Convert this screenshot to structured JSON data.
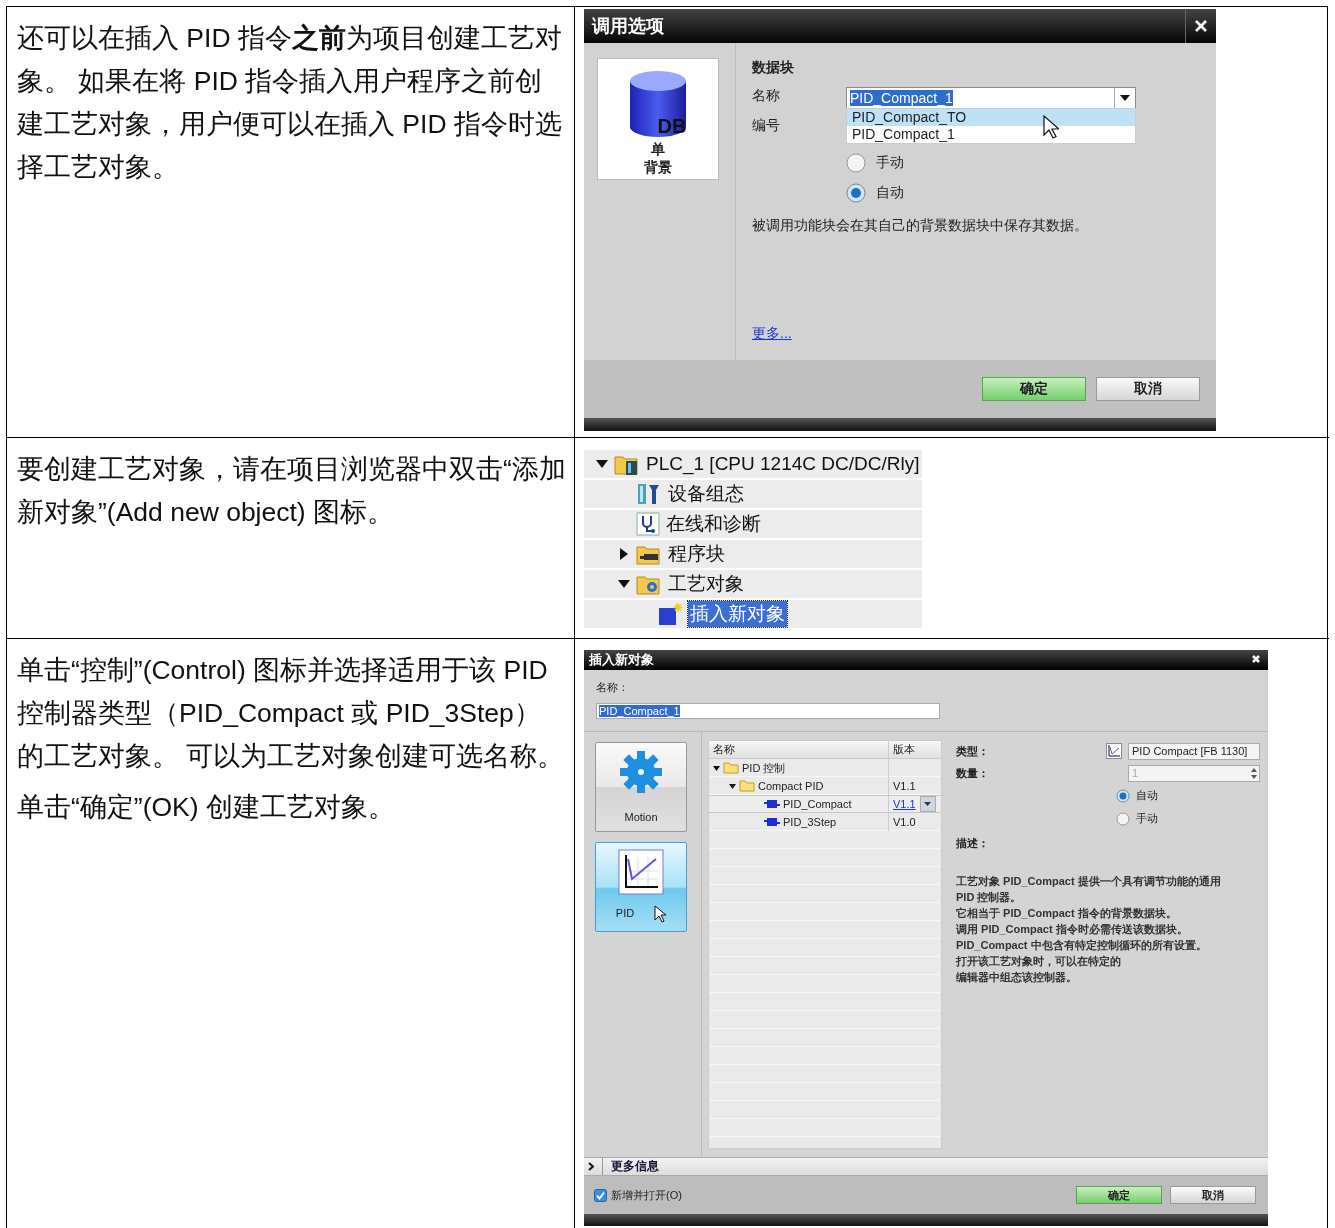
{
  "rows": [
    {
      "paragraphs": [
        "还可以在插入 PID 指令**之前**为项目创建工艺对象。 如果在将 PID 指令插入用户程序之前创建工艺对象，用户便可以在插入 PID 指令时选择工艺对象。"
      ],
      "kind": "call_options_dialog"
    },
    {
      "paragraphs": [
        "要创建工艺对象，请在项目浏览器中双击“添加新对象”(Add new object) 图标。"
      ],
      "kind": "project_tree"
    },
    {
      "paragraphs": [
        "单击“控制”(Control) 图标并选择适用于该 PID 控制器类型（PID_Compact 或 PID_3Step）的工艺对象。 可以为工艺对象创建可选名称。",
        "单击“确定”(OK) 创建工艺对象。"
      ],
      "kind": "insert_object_dialog"
    }
  ],
  "call_options_dialog": {
    "title": "调用选项",
    "tile": {
      "icon_text": "DB",
      "lines": [
        "单",
        "背景"
      ]
    },
    "section": "数据块",
    "name_label": "名称",
    "name_value": "PID_Compact_1",
    "number_label": "编号",
    "dropdown_options": [
      {
        "label": "PID_Compact_TO",
        "selected": true
      },
      {
        "label": "PID_Compact_1",
        "selected": false
      }
    ],
    "radios": [
      {
        "label": "手动",
        "selected": false
      },
      {
        "label": "自动",
        "selected": true
      }
    ],
    "note": "被调用功能块会在其自己的背景数据块中保存其数据。",
    "link": "更多...",
    "buttons": [
      {
        "label": "确定",
        "kind": "primary"
      },
      {
        "label": "取消",
        "kind": "normal"
      }
    ]
  },
  "project_tree": {
    "nodes": [
      {
        "label": "PLC_1 [CPU 1214C DC/DC/Rly]",
        "kind": "plc",
        "expanded": true,
        "selected": false,
        "children": [
          {
            "label": "设备组态",
            "kind": "device",
            "selected": false
          },
          {
            "label": "在线和诊断",
            "kind": "diagnostics",
            "selected": false
          },
          {
            "label": "程序块",
            "kind": "blocks",
            "expanded": false,
            "selected": false
          },
          {
            "label": "工艺对象",
            "kind": "technology",
            "expanded": true,
            "selected": false,
            "children": [
              {
                "label": "插入新对象",
                "kind": "new",
                "selected": true
              }
            ]
          }
        ]
      }
    ]
  },
  "insert_object_dialog": {
    "title": "插入新对象",
    "name_label": "名称：",
    "name_value": "PID_Compact_1",
    "categories": [
      {
        "label": "Motion",
        "kind": "gear",
        "selected": false
      },
      {
        "label": "PID",
        "kind": "chart",
        "selected": true
      }
    ],
    "columns": [
      "名称",
      "版本"
    ],
    "items": [
      {
        "label": "PID 控制",
        "kind": "folder",
        "expanded": true,
        "selected": false,
        "children": [
          {
            "label": "Compact PID",
            "kind": "folder",
            "version": "V1.1",
            "expanded": true,
            "selected": false,
            "children": [
              {
                "label": "PID_Compact",
                "kind": "block",
                "version": "V1.1",
                "selected": true
              },
              {
                "label": "PID_3Step",
                "kind": "block",
                "version": "V1.0",
                "selected": false
              }
            ]
          }
        ]
      }
    ],
    "type_label": "类型：",
    "type_value": "PID Compact [FB 1130]",
    "count_label": "数量：",
    "count_value": "1",
    "count_disabled": true,
    "radios": [
      {
        "label": "自动",
        "selected": true
      },
      {
        "label": "手动",
        "selected": false
      }
    ],
    "description_label": "描述：",
    "description": [
      "工艺对象 PID_Compact 提供一个具有调节功能的通用",
      "PID 控制器。",
      "它相当于 PID_Compact 指令的背景数据块。",
      "调用 PID_Compact 指令时必需传送该数据块。",
      "PID_Compact 中包含有特定控制循环的所有设置。",
      "打开该工艺对象时，可以在特定的",
      "编辑器中组态该控制器。"
    ],
    "more_info": {
      "label": "更多信息",
      "expanded": false
    },
    "open_checkbox": {
      "label": "新增并打开(O)",
      "checked": true
    },
    "buttons": [
      {
        "label": "确定",
        "kind": "primary"
      },
      {
        "label": "取消",
        "kind": "normal"
      }
    ]
  }
}
